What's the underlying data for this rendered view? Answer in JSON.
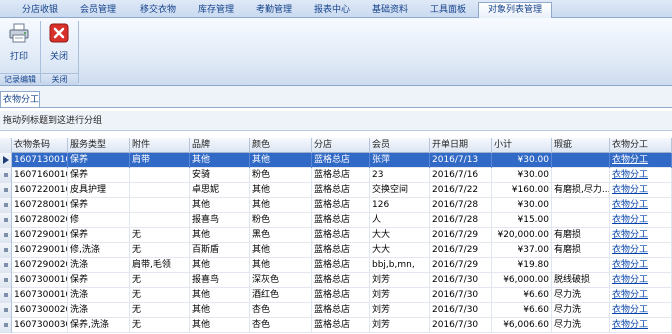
{
  "menu": {
    "tabs": [
      {
        "label": "分店收银"
      },
      {
        "label": "会员管理"
      },
      {
        "label": "移交衣物"
      },
      {
        "label": "库存管理"
      },
      {
        "label": "考勤管理"
      },
      {
        "label": "报表中心"
      },
      {
        "label": "基础资料"
      },
      {
        "label": "工具面板"
      },
      {
        "label": "对象列表管理"
      }
    ],
    "active_tab": "对象列表管理"
  },
  "ribbon": {
    "print_label": "打印",
    "close_label": "关闭",
    "group1_label": "记录编辑",
    "group2_label": "关闭"
  },
  "document_tab": "衣物分工",
  "group_hint": "拖动列标题到这进行分组",
  "grid": {
    "columns": [
      "衣物条码",
      "服务类型",
      "附件",
      "品牌",
      "颜色",
      "分店",
      "会员",
      "开单日期",
      "小计",
      "瑕疵",
      "衣物分工"
    ],
    "rows": [
      {
        "c": [
          "16071300101",
          "保养",
          "肩带",
          "其他",
          "其他",
          "蓝格总店",
          "张萍",
          "2016/7/13",
          "¥30.00",
          "",
          "衣物分工"
        ],
        "selected": true
      },
      {
        "c": [
          "16071600101",
          "保养",
          "",
          "安骑",
          "粉色",
          "蓝格总店",
          "23",
          "2016/7/16",
          "¥30.00",
          "",
          "衣物分工"
        ]
      },
      {
        "c": [
          "16072200101",
          "皮具护理",
          "",
          "卓思妮",
          "其他",
          "蓝格总店",
          "交换空间",
          "2016/7/22",
          "¥160.00",
          "有磨损,尽力...",
          "衣物分工"
        ]
      },
      {
        "c": [
          "16072800101",
          "保养",
          "",
          "其他",
          "其他",
          "蓝格总店",
          "126",
          "2016/7/28",
          "¥30.00",
          "",
          "衣物分工"
        ]
      },
      {
        "c": [
          "16072800201",
          "修",
          "",
          "报喜鸟",
          "粉色",
          "蓝格总店",
          "人",
          "2016/7/28",
          "¥15.00",
          "",
          "衣物分工"
        ]
      },
      {
        "c": [
          "16072900101",
          "保养",
          "无",
          "其他",
          "黑色",
          "蓝格总店",
          "大大",
          "2016/7/29",
          "¥20,000.00",
          "有磨损",
          "衣物分工"
        ]
      },
      {
        "c": [
          "16072900101",
          "修,洗涤",
          "无",
          "百斯盾",
          "其他",
          "蓝格总店",
          "大大",
          "2016/7/29",
          "¥37.00",
          "有磨损",
          "衣物分工"
        ]
      },
      {
        "c": [
          "16072900201",
          "洗涤",
          "肩带,毛领",
          "其他",
          "其他",
          "蓝格总店",
          "bbj,b,mn,",
          "2016/7/29",
          "¥19.80",
          "",
          "衣物分工"
        ]
      },
      {
        "c": [
          "16073000101",
          "保养",
          "无",
          "报喜鸟",
          "深灰色",
          "蓝格总店",
          "刘芳",
          "2016/7/30",
          "¥6,000.00",
          "脱线破损",
          "衣物分工"
        ]
      },
      {
        "c": [
          "16073000102",
          "洗涤",
          "无",
          "其他",
          "酒红色",
          "蓝格总店",
          "刘芳",
          "2016/7/30",
          "¥6.60",
          "尽力洗",
          "衣物分工"
        ]
      },
      {
        "c": [
          "16073000201",
          "洗涤",
          "无",
          "其他",
          "杏色",
          "蓝格总店",
          "刘芳",
          "2016/7/30",
          "¥6.60",
          "尽力洗",
          "衣物分工"
        ]
      },
      {
        "c": [
          "16073000301",
          "保养,洗涤",
          "无",
          "其他",
          "杏色",
          "蓝格总店",
          "刘芳",
          "2016/7/30",
          "¥6,006.60",
          "尽力洗",
          "衣物分工"
        ]
      }
    ]
  }
}
